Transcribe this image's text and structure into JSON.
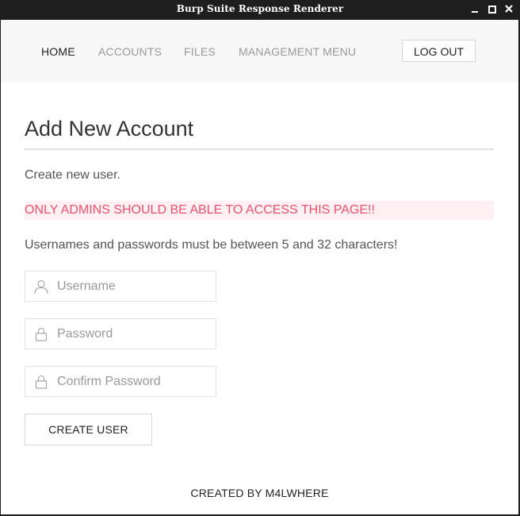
{
  "window": {
    "title": "Burp Suite Response Renderer"
  },
  "nav": {
    "home": "HOME",
    "accounts": "ACCOUNTS",
    "files": "FILES",
    "management": "MANAGEMENT MENU",
    "logout": "LOG OUT"
  },
  "page": {
    "heading": "Add New Account",
    "lead": "Create new user.",
    "alert": "ONLY ADMINS SHOULD BE ABLE TO ACCESS THIS PAGE!!",
    "note": "Usernames and passwords must be between 5 and 32 characters!"
  },
  "form": {
    "username_placeholder": "Username",
    "password_placeholder": "Password",
    "confirm_placeholder": "Confirm Password",
    "submit_label": "CREATE USER",
    "username_icon": "user-icon",
    "password_icon": "lock-icon"
  },
  "footer": {
    "text": "CREATED BY M4LWHERE"
  },
  "colors": {
    "alert_text": "#f0506e",
    "alert_bg": "#fef0f3",
    "navbar_bg": "#f7f7f7"
  }
}
